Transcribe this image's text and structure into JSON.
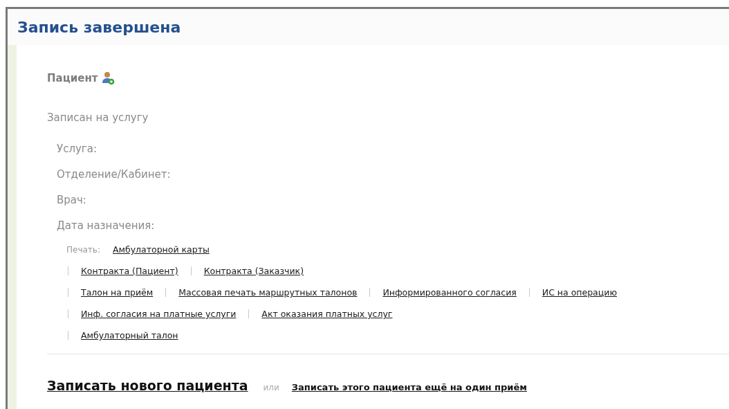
{
  "title": "Запись завершена",
  "patient": {
    "label": "Пациент"
  },
  "service_heading": "Записан на услугу",
  "fields": [
    "Услуга:",
    "Отделение/Кабинет:",
    "Врач:",
    "Дата назначения:"
  ],
  "print": {
    "label": "Печать:",
    "rows": [
      [
        "Амбулаторной карты"
      ],
      [
        "Контракта (Пациент)",
        "Контракта (Заказчик)"
      ],
      [
        "Талон на приём",
        "Массовая печать маршрутных талонов",
        "Информированного согласия",
        "ИС на операцию"
      ],
      [
        "Инф. согласия на платные услуги",
        "Акт оказания платных услуг"
      ],
      [
        "Амбулаторный талон"
      ]
    ]
  },
  "actions": {
    "primary": "Записать нового пациента",
    "separator": "или",
    "secondary": "Записать этого пациента ещё на один приём"
  }
}
